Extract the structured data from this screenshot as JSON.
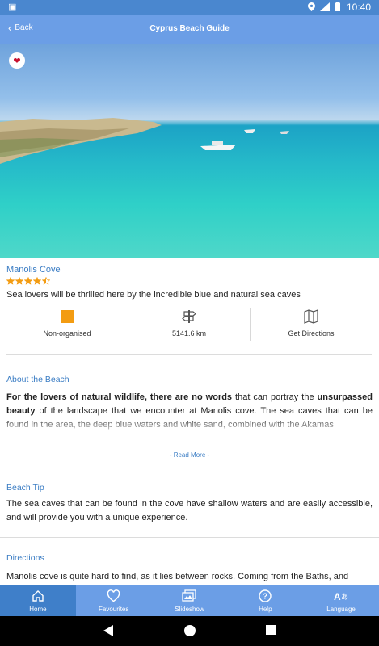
{
  "status_bar": {
    "time": "10:40"
  },
  "app_bar": {
    "back_label": "Back",
    "title": "Cyprus Beach Guide"
  },
  "beach": {
    "name": "Manolis Cove",
    "rating": 4.5,
    "rating_max": 5,
    "tagline": "Sea lovers will be thrilled here by the incredible blue and natural sea caves"
  },
  "info": {
    "organised": "Non-organised",
    "distance": "5141.6 km",
    "directions": "Get Directions",
    "organised_color": "#f39c12"
  },
  "about": {
    "heading": "About the Beach",
    "bold1": "For the lovers of natural wildlife, there are no words",
    "text1": " that can portray the ",
    "bold2": "unsurpassed beauty",
    "text2": " of the landscape that we encounter at Manolis cove. The sea caves that can be found in the area, the deep blue waters and white sand, combined with the Akamas",
    "read_more": "- Read More -"
  },
  "tip": {
    "heading": "Beach Tip",
    "text": "The sea caves that can be found in the cove have shallow waters and are easily accessible, and will provide you with a unique experience."
  },
  "directions_section": {
    "heading": "Directions",
    "text": "Manolis cove is quite hard to find, as it lies between rocks. Coming from the Baths, and"
  },
  "bottom_nav": [
    {
      "label": "Home",
      "icon": "home-icon",
      "active": true
    },
    {
      "label": "Favourites",
      "icon": "heart-icon",
      "active": false
    },
    {
      "label": "Slideshow",
      "icon": "slideshow-icon",
      "active": false
    },
    {
      "label": "Help",
      "icon": "help-icon",
      "active": false
    },
    {
      "label": "Language",
      "icon": "language-icon",
      "active": false
    }
  ],
  "colors": {
    "accent": "#6b9ee6",
    "accent_dark": "#3f7fc9",
    "link": "#3b7dc4",
    "star": "#f39c12",
    "favourite": "#c8102e"
  }
}
